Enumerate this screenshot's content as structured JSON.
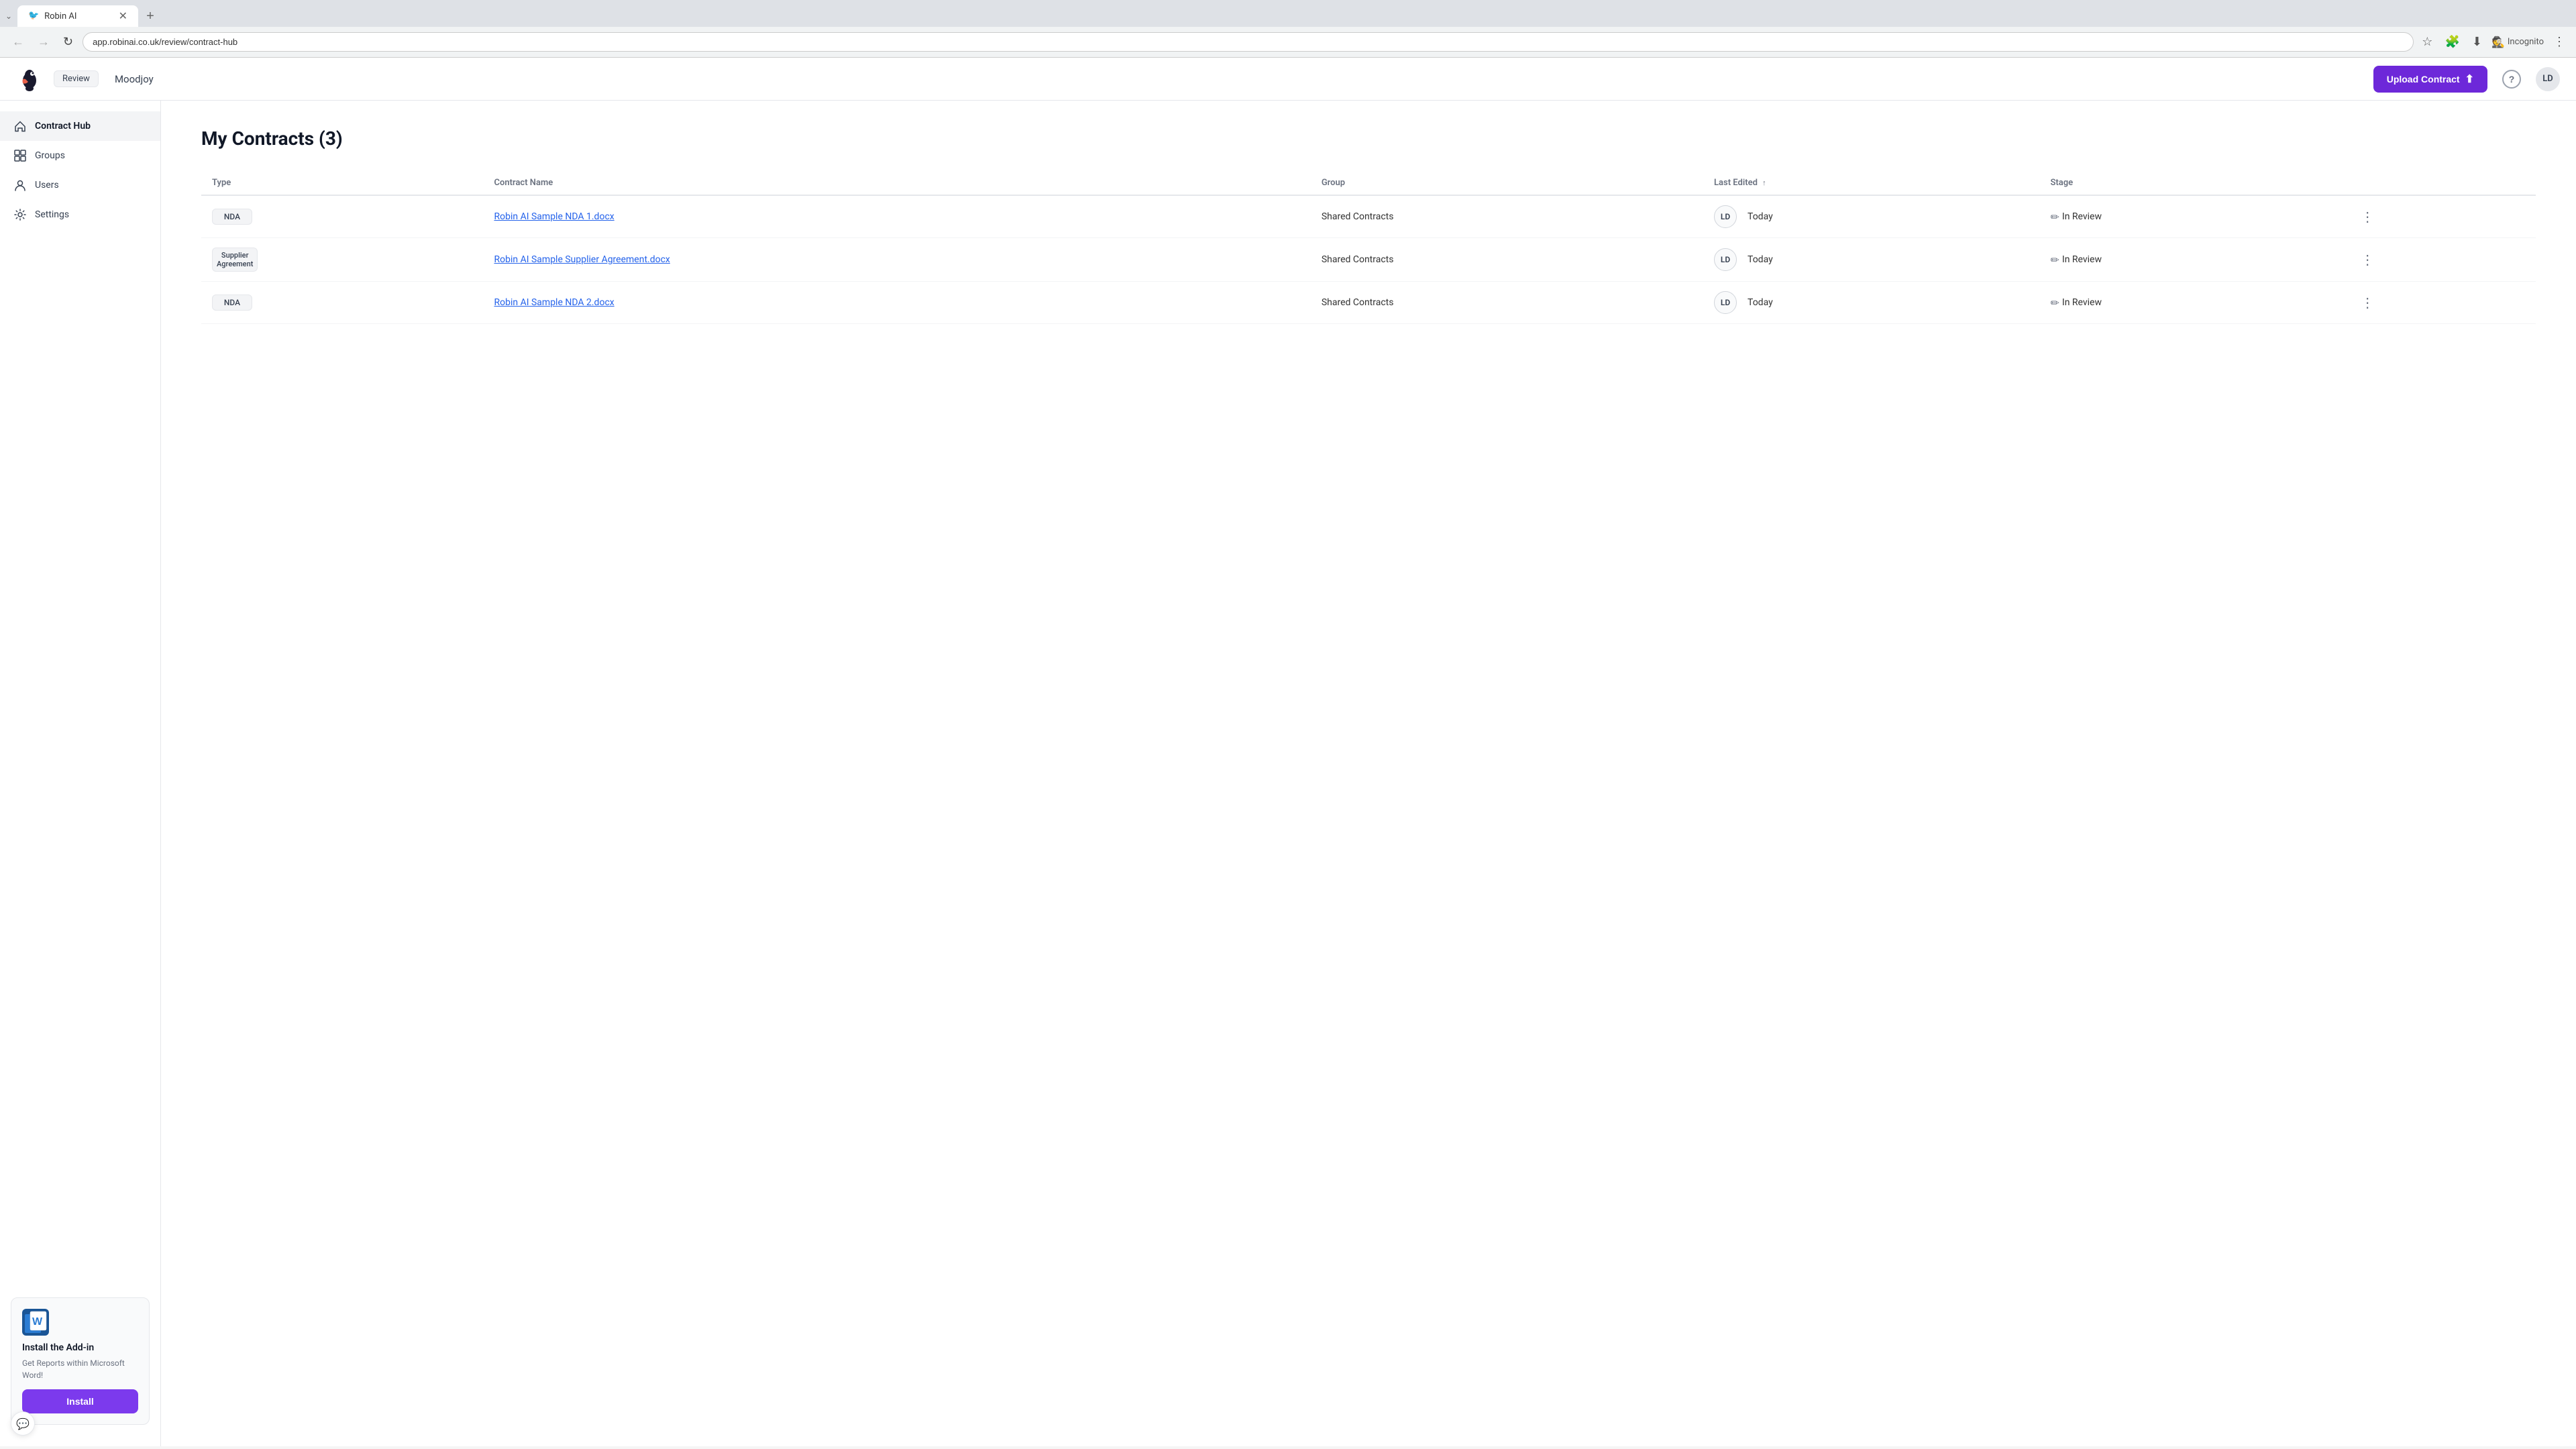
{
  "browser": {
    "tab_title": "Robin AI",
    "tab_favicon": "🐦",
    "url": "app.robinai.co.uk/review/contract-hub",
    "new_tab_label": "+",
    "back_label": "←",
    "forward_label": "→",
    "reload_label": "↻",
    "incognito_label": "Incognito"
  },
  "header": {
    "review_badge": "Review",
    "company_name": "Moodjoy",
    "upload_btn_label": "Upload Contract",
    "help_icon": "?",
    "avatar_initials": "LD"
  },
  "sidebar": {
    "items": [
      {
        "id": "contract-hub",
        "label": "Contract Hub",
        "active": true
      },
      {
        "id": "groups",
        "label": "Groups",
        "active": false
      },
      {
        "id": "users",
        "label": "Users",
        "active": false
      },
      {
        "id": "settings",
        "label": "Settings",
        "active": false
      }
    ],
    "addin": {
      "title": "Install the Add-in",
      "description": "Get Reports within Microsoft Word!",
      "install_label": "Install"
    }
  },
  "main": {
    "page_title": "My Contracts (3)",
    "table": {
      "columns": [
        {
          "id": "type",
          "label": "Type"
        },
        {
          "id": "contract_name",
          "label": "Contract Name"
        },
        {
          "id": "group",
          "label": "Group"
        },
        {
          "id": "last_edited",
          "label": "Last Edited",
          "sortable": true,
          "sort_direction": "asc"
        },
        {
          "id": "stage",
          "label": "Stage"
        }
      ],
      "rows": [
        {
          "type": "NDA",
          "contract_name": "Robin AI Sample NDA 1.docx",
          "group": "Shared Contracts",
          "avatar": "LD",
          "last_edited": "Today",
          "stage": "In Review"
        },
        {
          "type": "Supplier Agreement",
          "contract_name": "Robin AI Sample Supplier Agreement.docx",
          "group": "Shared Contracts",
          "avatar": "LD",
          "last_edited": "Today",
          "stage": "In Review"
        },
        {
          "type": "NDA",
          "contract_name": "Robin AI Sample NDA 2.docx",
          "group": "Shared Contracts",
          "avatar": "LD",
          "last_edited": "Today",
          "stage": "In Review"
        }
      ]
    }
  },
  "colors": {
    "accent": "#6d28d9",
    "link": "#2563eb",
    "badge_bg": "#f3f4f6"
  }
}
